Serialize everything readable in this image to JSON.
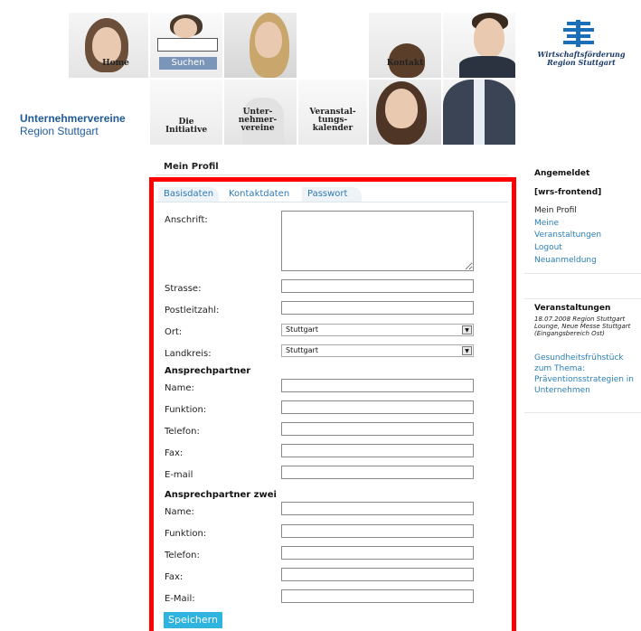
{
  "header": {
    "nav": {
      "home": "Home",
      "search_button": "Suchen",
      "contact": "Kontakt",
      "initiative": "Die\nInitiative",
      "member_associations": "Unter-\nnehmer-\nvereine",
      "event_calendar": "Veranstal-\ntungs-\nkalender"
    },
    "brand_title": "Unternehmervereine",
    "brand_subtitle": "Region Stuttgart",
    "partner_logo_text": "Wirtschaftsförderung\nRegion Stuttgart"
  },
  "main": {
    "heading": "Mein Profil",
    "tabs": [
      {
        "label": "Basisdaten"
      },
      {
        "label": "Kontaktdaten"
      },
      {
        "label": "Passwort"
      }
    ],
    "address_section": {
      "anschrift_label": "Anschrift:",
      "strasse_label": "Strasse:",
      "plz_label": "Postleitzahl:",
      "ort_label": "Ort:",
      "ort_value": "Stuttgart",
      "landkreis_label": "Landkreis:",
      "landkreis_value": "Stuttgart"
    },
    "contact_person": {
      "title": "Ansprechpartner",
      "name_label": "Name:",
      "funktion_label": "Funktion:",
      "telefon_label": "Telefon:",
      "fax_label": "Fax:",
      "email_label": "E-mail"
    },
    "contact_person_2": {
      "title": "Ansprechpartner zwei",
      "name_label": "Name:",
      "funktion_label": "Funktion:",
      "telefon_label": "Telefon:",
      "fax_label": "Fax:",
      "email_label": "E-Mail:"
    },
    "save_button": "Speichern",
    "highlight_color": "#ff0000"
  },
  "sidebar": {
    "logged_in_heading": "Angemeldet",
    "username": "[wrs-frontend]",
    "my_profile": "Mein Profil",
    "links": [
      "Meine\nVeranstaltungen",
      "Logout",
      "Neuanmeldung"
    ],
    "events_heading": "Veranstaltungen",
    "event_meta": "18.07.2008 Region Stuttgart Lounge, Neue Messe Stuttgart (Eingangsbereich Ost)",
    "event_link": "Gesundheitsfrühstück zum Thema: Präventionsstrategien in Unternehmen"
  },
  "colors": {
    "brand_blue": "#1f5a9a",
    "link_blue": "#2a7fb8",
    "button_blue": "#2fb3df",
    "search_button": "#7b95b8"
  }
}
